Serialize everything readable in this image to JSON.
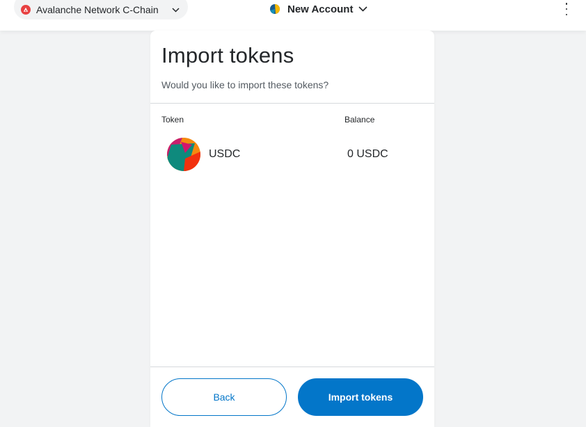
{
  "header": {
    "network_label": "Avalanche Network C-Chain",
    "network_icon": "avalanche-icon",
    "account_name": "New Account",
    "menu_icon": "kebab-menu-icon"
  },
  "import": {
    "title": "Import tokens",
    "subtitle": "Would you like to import these tokens?",
    "columns": {
      "token": "Token",
      "balance": "Balance"
    },
    "tokens": [
      {
        "symbol": "USDC",
        "balance": "0 USDC",
        "icon": "usdc-token-icon"
      }
    ],
    "back_label": "Back",
    "import_label": "Import tokens"
  },
  "colors": {
    "primary": "#0376c9",
    "avalanche_red": "#e84142",
    "background": "#f2f3f4"
  }
}
